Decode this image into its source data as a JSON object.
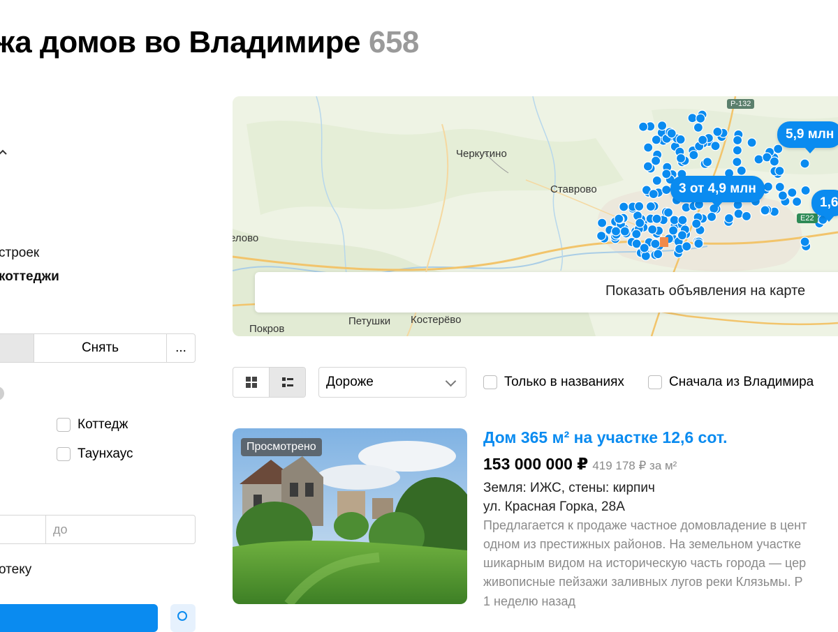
{
  "header": {
    "title": "жа домов во Владимире",
    "count": "658"
  },
  "filters": {
    "type_item_partial": "строек",
    "type_item_selected_partial": "коттеджи",
    "deal_rent": "Снять",
    "deal_more": "...",
    "house_type_cottage": "Коттедж",
    "house_type_townhouse": "Таунхаус",
    "range_to_placeholder": "до",
    "mortgage_partial": "отеку"
  },
  "map": {
    "labels": [
      "Черкутино",
      "Ставрово",
      "елово",
      "Петушки",
      "Костерёво",
      "Покров"
    ],
    "road_badges": [
      "Р-132",
      "E22"
    ],
    "bubbles": [
      "5,9 млн",
      "3 от 4,9 млн",
      "1,6"
    ],
    "cta_label": "Показать объявления на карте",
    "marker_color": "#0a8bf0"
  },
  "toolbar": {
    "sort_value": "Дороже",
    "only_in_titles": "Только в названиях",
    "first_from_city": "Сначала из Владимира"
  },
  "listing": {
    "badge": "Просмотрено",
    "title": "Дом 365 м² на участке 12,6 сот.",
    "price": "153 000 000 ₽",
    "price_per_m2": "419 178 ₽ за м²",
    "params": "Земля: ИЖС, стены: кирпич",
    "address": "ул. Красная Горка, 28А",
    "description_lines": [
      "Предлагается к продаже частное домовладение в цент",
      "одном из престижных районов. На земельном участке",
      "шикарным видом на историческую часть города — цер",
      "живописные пейзажи заливных лугов реки Клязьмы. Р"
    ],
    "date": "1 неделю назад"
  },
  "colors": {
    "accent": "#0a8bf0",
    "muted_text": "#8a8a8a"
  }
}
